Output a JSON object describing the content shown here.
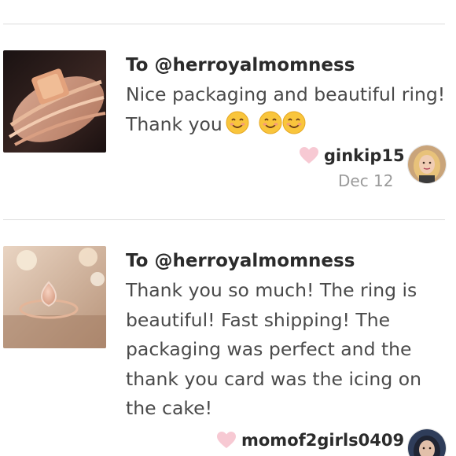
{
  "reviews": [
    {
      "recipient": "To @herroyalmomness",
      "text": "Nice packaging and beautiful ring! Thank you",
      "emoji_icons": [
        "smiling-face-icon",
        "smiling-face-icon",
        "smiling-face-icon"
      ],
      "username": "ginkip15",
      "date": "Dec 12",
      "thumbnail": "ring-photo-stacked-bands",
      "avatar": "user-avatar-blonde"
    },
    {
      "recipient": "To @herroyalmomness",
      "text": "Thank you so much! The ring is beautiful! Fast shipping! The packaging was perfect and the thank you card was the icing on the cake!",
      "username": "momof2girls0409",
      "thumbnail": "ring-photo-pear-morganite",
      "avatar": "user-avatar-dark-hair"
    }
  ],
  "colors": {
    "heart": "#f7c9d3",
    "divider": "#dcdcdc",
    "date": "#9a9a9a",
    "text": "#4a4a4a"
  }
}
